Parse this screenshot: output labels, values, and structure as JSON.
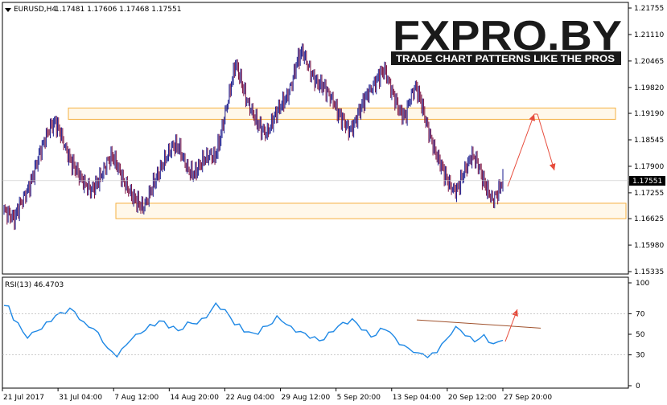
{
  "header": {
    "symbol": "EURUSD,H4",
    "ohlc": "1.17481 1.17606 1.17468 1.17551",
    "rsi_label": "RSI(13) 46.4703"
  },
  "logo": {
    "main": "FXPRO.BY",
    "tagline": "TRADE CHART PATTERNS LIKE THE PROS"
  },
  "colors": {
    "bull": "#1a1a8c",
    "bear": "#7a1040",
    "rsi": "#1e88e5",
    "zone": "#f5b041",
    "arrow": "#e74c3c",
    "trendline": "#a0522d",
    "current_price_bg": "#000000"
  },
  "chart_data": [
    {
      "type": "candlestick",
      "ylim": [
        1.15335,
        1.21755
      ],
      "y_ticks": [
        "1.21755",
        "1.21110",
        "1.20465",
        "1.19820",
        "1.19190",
        "1.18545",
        "1.17900",
        "1.17255",
        "1.16625",
        "1.15980",
        "1.15335"
      ],
      "current_price": "1.17551",
      "x_ticks": [
        "21 Jul 2017",
        "31 Jul 04:00",
        "7 Aug 12:00",
        "14 Aug 20:00",
        "22 Aug 04:00",
        "29 Aug 12:00",
        "5 Sep 20:00",
        "13 Sep 04:00",
        "20 Sep 12:00",
        "27 Sep 20:00"
      ],
      "close_path": [
        1.1685,
        1.1672,
        1.166,
        1.1695,
        1.172,
        1.1742,
        1.178,
        1.1825,
        1.186,
        1.1885,
        1.1895,
        1.187,
        1.1835,
        1.18,
        1.178,
        1.176,
        1.1745,
        1.173,
        1.1745,
        1.177,
        1.18,
        1.1815,
        1.179,
        1.176,
        1.174,
        1.1715,
        1.17,
        1.169,
        1.1715,
        1.1745,
        1.177,
        1.18,
        1.1825,
        1.184,
        1.1835,
        1.1805,
        1.178,
        1.177,
        1.179,
        1.181,
        1.182,
        1.181,
        1.1855,
        1.192,
        1.198,
        1.204,
        1.2,
        1.196,
        1.193,
        1.19,
        1.188,
        1.187,
        1.1895,
        1.192,
        1.194,
        1.196,
        1.1995,
        1.2045,
        1.207,
        1.204,
        1.201,
        1.199,
        1.1985,
        1.197,
        1.195,
        1.1915,
        1.19,
        1.188,
        1.189,
        1.192,
        1.195,
        1.1975,
        1.199,
        1.201,
        1.2025,
        1.199,
        1.1955,
        1.192,
        1.191,
        1.196,
        1.1985,
        1.195,
        1.19,
        1.186,
        1.182,
        1.179,
        1.176,
        1.174,
        1.173,
        1.176,
        1.179,
        1.182,
        1.18,
        1.176,
        1.173,
        1.171,
        1.1725,
        1.1755
      ],
      "support_zone": [
        1.16625,
        1.17
      ],
      "resistance_zone": [
        1.19045,
        1.1932
      ]
    },
    {
      "type": "line",
      "name": "RSI(13)",
      "ylim": [
        0,
        100
      ],
      "y_ticks": [
        "100",
        "70",
        "50",
        "30",
        "0"
      ],
      "values": [
        78,
        76,
        66,
        60,
        52,
        48,
        50,
        54,
        56,
        60,
        64,
        68,
        70,
        72,
        74,
        72,
        66,
        60,
        58,
        56,
        50,
        44,
        36,
        32,
        30,
        34,
        40,
        46,
        48,
        52,
        54,
        58,
        60,
        62,
        62,
        58,
        56,
        54,
        56,
        60,
        62,
        60,
        64,
        68,
        72,
        80,
        76,
        72,
        68,
        60,
        58,
        54,
        52,
        50,
        52,
        56,
        58,
        62,
        66,
        64,
        60,
        56,
        54,
        52,
        50,
        48,
        46,
        44,
        46,
        50,
        54,
        58,
        60,
        62,
        64,
        60,
        56,
        52,
        48,
        50,
        54,
        56,
        52,
        46,
        42,
        38,
        36,
        34,
        30,
        32,
        28,
        30,
        34,
        40,
        44,
        52,
        56,
        54,
        50,
        46,
        44,
        46,
        48,
        44,
        40,
        42,
        46
      ]
    }
  ]
}
